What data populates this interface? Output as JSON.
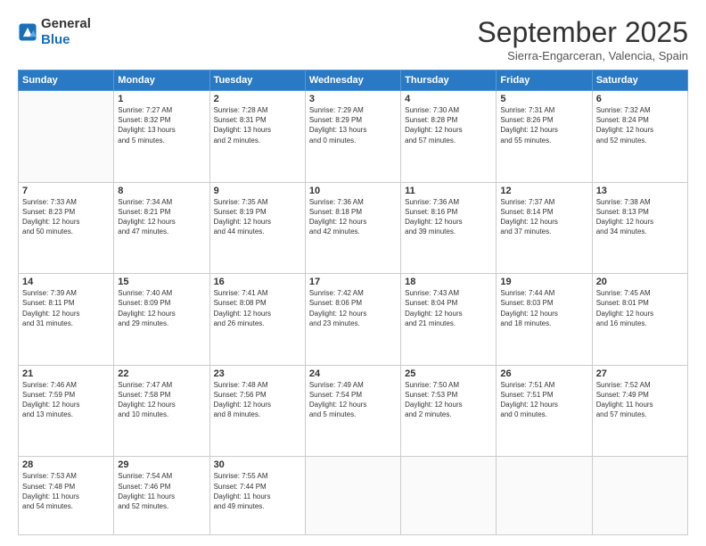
{
  "header": {
    "logo_line1": "General",
    "logo_line2": "Blue",
    "title": "September 2025",
    "location": "Sierra-Engarceran, Valencia, Spain"
  },
  "days_of_week": [
    "Sunday",
    "Monday",
    "Tuesday",
    "Wednesday",
    "Thursday",
    "Friday",
    "Saturday"
  ],
  "weeks": [
    [
      {
        "day": "",
        "info": ""
      },
      {
        "day": "1",
        "info": "Sunrise: 7:27 AM\nSunset: 8:32 PM\nDaylight: 13 hours\nand 5 minutes."
      },
      {
        "day": "2",
        "info": "Sunrise: 7:28 AM\nSunset: 8:31 PM\nDaylight: 13 hours\nand 2 minutes."
      },
      {
        "day": "3",
        "info": "Sunrise: 7:29 AM\nSunset: 8:29 PM\nDaylight: 13 hours\nand 0 minutes."
      },
      {
        "day": "4",
        "info": "Sunrise: 7:30 AM\nSunset: 8:28 PM\nDaylight: 12 hours\nand 57 minutes."
      },
      {
        "day": "5",
        "info": "Sunrise: 7:31 AM\nSunset: 8:26 PM\nDaylight: 12 hours\nand 55 minutes."
      },
      {
        "day": "6",
        "info": "Sunrise: 7:32 AM\nSunset: 8:24 PM\nDaylight: 12 hours\nand 52 minutes."
      }
    ],
    [
      {
        "day": "7",
        "info": "Sunrise: 7:33 AM\nSunset: 8:23 PM\nDaylight: 12 hours\nand 50 minutes."
      },
      {
        "day": "8",
        "info": "Sunrise: 7:34 AM\nSunset: 8:21 PM\nDaylight: 12 hours\nand 47 minutes."
      },
      {
        "day": "9",
        "info": "Sunrise: 7:35 AM\nSunset: 8:19 PM\nDaylight: 12 hours\nand 44 minutes."
      },
      {
        "day": "10",
        "info": "Sunrise: 7:36 AM\nSunset: 8:18 PM\nDaylight: 12 hours\nand 42 minutes."
      },
      {
        "day": "11",
        "info": "Sunrise: 7:36 AM\nSunset: 8:16 PM\nDaylight: 12 hours\nand 39 minutes."
      },
      {
        "day": "12",
        "info": "Sunrise: 7:37 AM\nSunset: 8:14 PM\nDaylight: 12 hours\nand 37 minutes."
      },
      {
        "day": "13",
        "info": "Sunrise: 7:38 AM\nSunset: 8:13 PM\nDaylight: 12 hours\nand 34 minutes."
      }
    ],
    [
      {
        "day": "14",
        "info": "Sunrise: 7:39 AM\nSunset: 8:11 PM\nDaylight: 12 hours\nand 31 minutes."
      },
      {
        "day": "15",
        "info": "Sunrise: 7:40 AM\nSunset: 8:09 PM\nDaylight: 12 hours\nand 29 minutes."
      },
      {
        "day": "16",
        "info": "Sunrise: 7:41 AM\nSunset: 8:08 PM\nDaylight: 12 hours\nand 26 minutes."
      },
      {
        "day": "17",
        "info": "Sunrise: 7:42 AM\nSunset: 8:06 PM\nDaylight: 12 hours\nand 23 minutes."
      },
      {
        "day": "18",
        "info": "Sunrise: 7:43 AM\nSunset: 8:04 PM\nDaylight: 12 hours\nand 21 minutes."
      },
      {
        "day": "19",
        "info": "Sunrise: 7:44 AM\nSunset: 8:03 PM\nDaylight: 12 hours\nand 18 minutes."
      },
      {
        "day": "20",
        "info": "Sunrise: 7:45 AM\nSunset: 8:01 PM\nDaylight: 12 hours\nand 16 minutes."
      }
    ],
    [
      {
        "day": "21",
        "info": "Sunrise: 7:46 AM\nSunset: 7:59 PM\nDaylight: 12 hours\nand 13 minutes."
      },
      {
        "day": "22",
        "info": "Sunrise: 7:47 AM\nSunset: 7:58 PM\nDaylight: 12 hours\nand 10 minutes."
      },
      {
        "day": "23",
        "info": "Sunrise: 7:48 AM\nSunset: 7:56 PM\nDaylight: 12 hours\nand 8 minutes."
      },
      {
        "day": "24",
        "info": "Sunrise: 7:49 AM\nSunset: 7:54 PM\nDaylight: 12 hours\nand 5 minutes."
      },
      {
        "day": "25",
        "info": "Sunrise: 7:50 AM\nSunset: 7:53 PM\nDaylight: 12 hours\nand 2 minutes."
      },
      {
        "day": "26",
        "info": "Sunrise: 7:51 AM\nSunset: 7:51 PM\nDaylight: 12 hours\nand 0 minutes."
      },
      {
        "day": "27",
        "info": "Sunrise: 7:52 AM\nSunset: 7:49 PM\nDaylight: 11 hours\nand 57 minutes."
      }
    ],
    [
      {
        "day": "28",
        "info": "Sunrise: 7:53 AM\nSunset: 7:48 PM\nDaylight: 11 hours\nand 54 minutes."
      },
      {
        "day": "29",
        "info": "Sunrise: 7:54 AM\nSunset: 7:46 PM\nDaylight: 11 hours\nand 52 minutes."
      },
      {
        "day": "30",
        "info": "Sunrise: 7:55 AM\nSunset: 7:44 PM\nDaylight: 11 hours\nand 49 minutes."
      },
      {
        "day": "",
        "info": ""
      },
      {
        "day": "",
        "info": ""
      },
      {
        "day": "",
        "info": ""
      },
      {
        "day": "",
        "info": ""
      }
    ]
  ]
}
